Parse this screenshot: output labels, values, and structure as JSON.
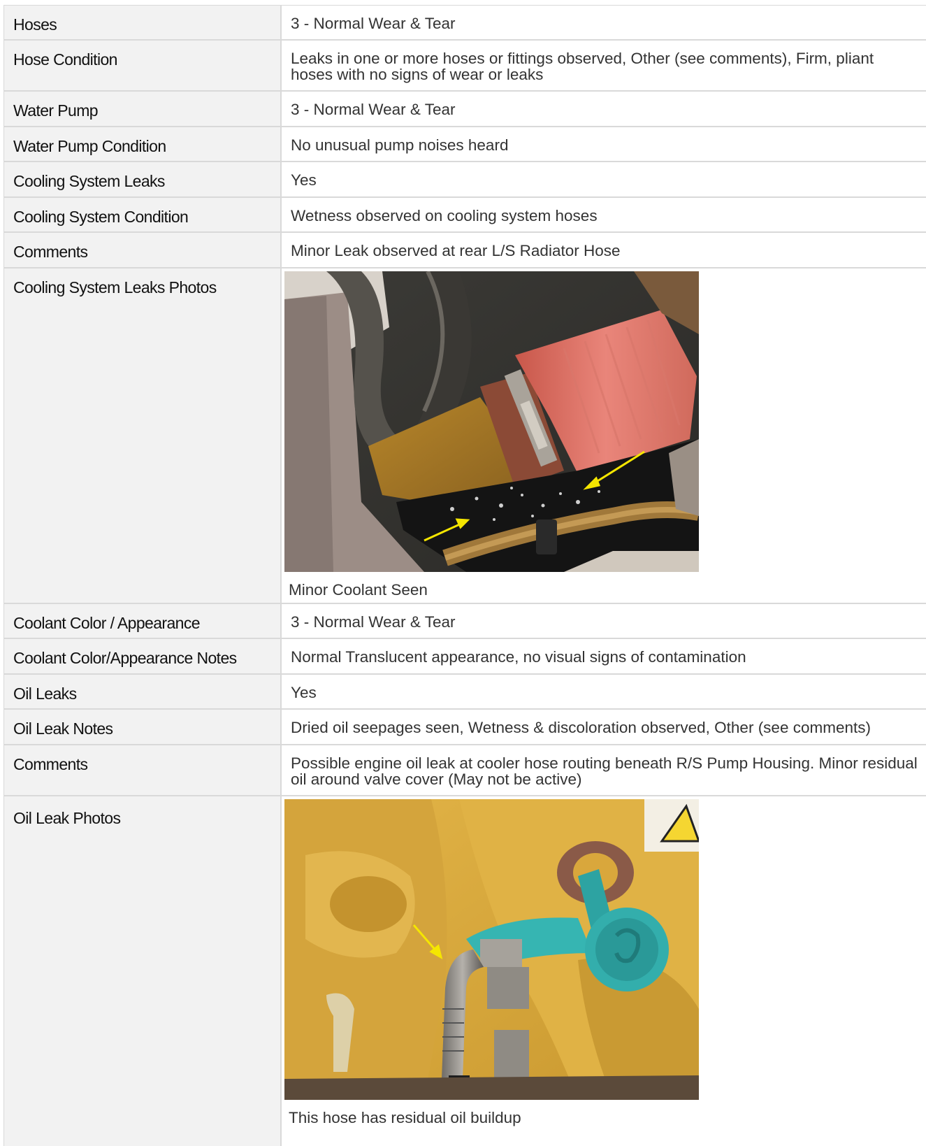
{
  "rows": [
    {
      "label": "Hoses",
      "value": "3 - Normal Wear & Tear"
    },
    {
      "label": "Hose Condition",
      "value": "Leaks in one or more hoses or fittings observed, Other (see comments), Firm, pliant hoses with no signs of wear or leaks"
    },
    {
      "label": "Water Pump",
      "value": "3 - Normal Wear & Tear"
    },
    {
      "label": "Water Pump Condition",
      "value": "No unusual pump noises heard"
    },
    {
      "label": "Cooling System Leaks",
      "value": "Yes"
    },
    {
      "label": "Cooling System Condition",
      "value": "Wetness observed on cooling system hoses"
    },
    {
      "label": "Comments",
      "value": "Minor Leak observed at rear L/S Radiator Hose"
    },
    {
      "label": "Cooling System Leaks Photos",
      "caption": "Minor Coolant Seen"
    },
    {
      "label": "Coolant Color / Appearance",
      "value": "3 - Normal Wear & Tear"
    },
    {
      "label": "Coolant Color/Appearance Notes",
      "value": "Normal Translucent appearance, no visual signs of contamination"
    },
    {
      "label": "Oil Leaks",
      "value": "Yes"
    },
    {
      "label": "Oil Leak Notes",
      "value": "Dried oil seepages seen, Wetness & discoloration observed, Other (see comments)"
    },
    {
      "label": "Comments",
      "value": "Possible engine oil leak at cooler hose routing beneath R/S Pump Housing. Minor residual oil around valve cover (May not be active)"
    },
    {
      "label": "Oil Leak Photos",
      "caption": "This hose has residual oil buildup"
    }
  ]
}
